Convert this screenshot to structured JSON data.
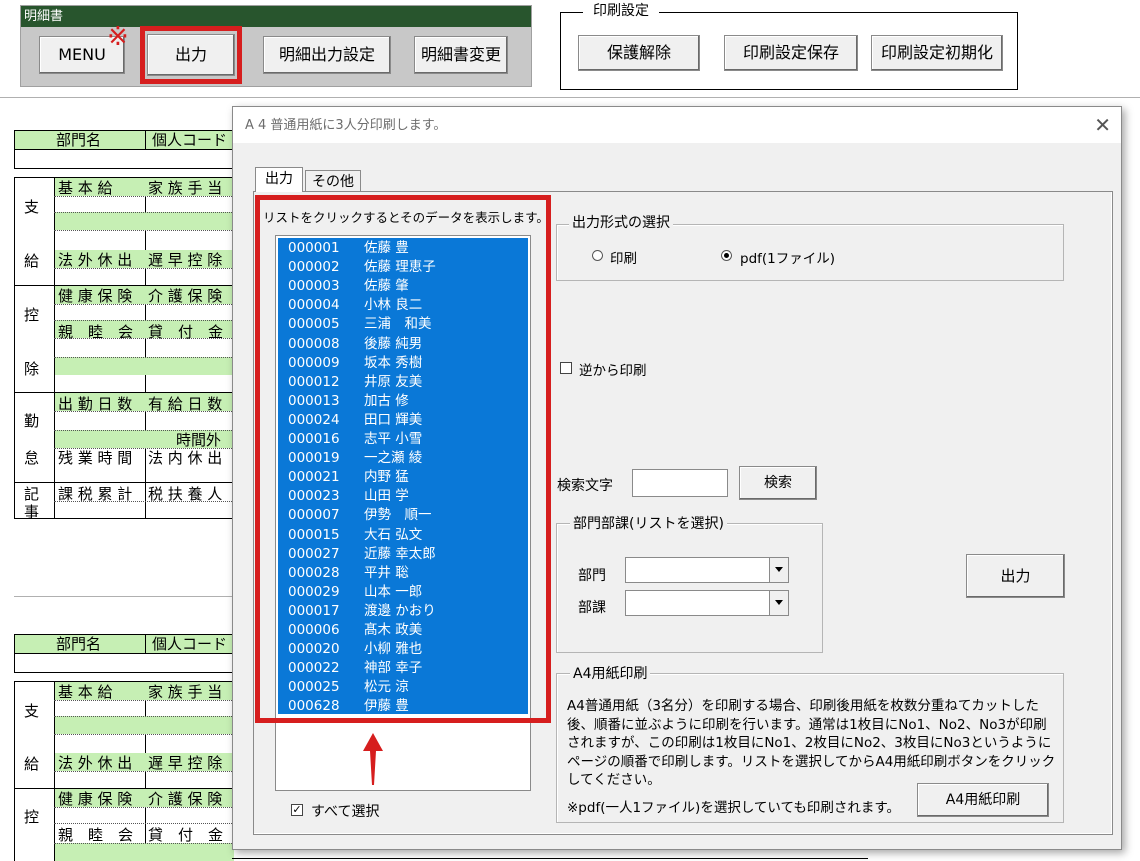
{
  "meisai_panel": {
    "title": "明細書",
    "buttons": {
      "menu": "MENU",
      "output": "出力",
      "settings": "明細出力設定",
      "change": "明細書変更"
    }
  },
  "print_settings": {
    "title": "印刷設定",
    "buttons": {
      "unprotect": "保護解除",
      "save": "印刷設定保存",
      "reset": "印刷設定初期化"
    }
  },
  "sheet": {
    "dept_header": "部門名",
    "personal_code_header": "個人コード",
    "side_labels": {
      "pay1": "支",
      "pay2": "給",
      "ded1": "控",
      "ded2": "除",
      "att1": "勤",
      "att2": "怠",
      "note1": "記",
      "note2": "事"
    },
    "cells": {
      "base_pay": "基 本 給",
      "family_allowance": "家 族 手 当",
      "leave_allowance": "法 外 休 出",
      "early_leave": "遅 早 控 除",
      "health_insurance": "健 康 保 険",
      "care_insurance": "介 護 保 険",
      "fellowship": "親　睦　会",
      "loan": "貸　付　金",
      "work_days": "出 勤 日 数",
      "paid_leave_days": "有 給 日 数",
      "overtime": "時間外",
      "overtime_hours": "残 業 時 間",
      "legal_holiday": "法 内 休 出",
      "taxable_total": "課 税 累 計",
      "tax_dependents": "税 扶 養 人"
    }
  },
  "dialog": {
    "title": "A 4 普通用紙に3人分印刷します。",
    "tabs": [
      "出力",
      "その他"
    ],
    "list_hint": "リストをクリックするとそのデータを表示します。",
    "list_items": [
      {
        "code": "000001",
        "name": "佐藤 豊"
      },
      {
        "code": "000002",
        "name": "佐藤 理恵子"
      },
      {
        "code": "000003",
        "name": "佐藤 肇"
      },
      {
        "code": "000004",
        "name": "小林 良二"
      },
      {
        "code": "000005",
        "name": "三浦　和美"
      },
      {
        "code": "000008",
        "name": "後藤 純男"
      },
      {
        "code": "000009",
        "name": "坂本 秀樹"
      },
      {
        "code": "000012",
        "name": "井原 友美"
      },
      {
        "code": "000013",
        "name": "加古 修"
      },
      {
        "code": "000024",
        "name": "田口 輝美"
      },
      {
        "code": "000016",
        "name": "志平 小雪"
      },
      {
        "code": "000019",
        "name": "一之瀬 綾"
      },
      {
        "code": "000021",
        "name": "内野 猛"
      },
      {
        "code": "000023",
        "name": "山田 学"
      },
      {
        "code": "000007",
        "name": "伊勢　順一"
      },
      {
        "code": "000015",
        "name": "大石 弘文"
      },
      {
        "code": "000027",
        "name": "近藤 幸太郎"
      },
      {
        "code": "000028",
        "name": "平井 聡"
      },
      {
        "code": "000029",
        "name": "山本 一郎"
      },
      {
        "code": "000017",
        "name": "渡邊 かおり"
      },
      {
        "code": "000006",
        "name": "髙木 政美"
      },
      {
        "code": "000020",
        "name": "小柳 雅也"
      },
      {
        "code": "000022",
        "name": "神部 幸子"
      },
      {
        "code": "000025",
        "name": "松元 涼"
      },
      {
        "code": "000628",
        "name": "伊藤 豊"
      }
    ],
    "select_all_label": "すべて選択",
    "select_all_checked": true,
    "output_format": {
      "title": "出力形式の選択",
      "option_print": "印刷",
      "option_pdf": "pdf(1ファイル)",
      "selected": "pdf(1ファイル)"
    },
    "reverse_print_label": "逆から印刷",
    "reverse_print_checked": false,
    "search_label": "検索文字",
    "search_value": "",
    "search_button": "検索",
    "dept_group": {
      "title": "部門部課(リストを選択)",
      "dept_label": "部門",
      "dept_value": "",
      "section_label": "部課",
      "section_value": ""
    },
    "output_button": "出力",
    "a4_group": {
      "title": "A4用紙印刷",
      "description": "A4普通用紙（3名分）を印刷する場合、印刷後用紙を枚数分重ねてカットした後、順番に並ぶように印刷を行います。通常は1枚目にNo1、No2、No3が印刷されますが、この印刷は1枚目にNo1、2枚目にNo2、3枚目にNo3というようにページの順番で印刷します。リストを選択してからA4用紙印刷ボタンをクリックしてください。",
      "note": "※pdf(一人1ファイル)を選択していても印刷されます。",
      "button": "A4用紙印刷"
    }
  },
  "annotation_mark": "※",
  "colors": {
    "list_selection": "#0a78d7",
    "highlight_red": "#d61e1e",
    "title_green": "#28552d",
    "cell_green": "#c6efb4"
  }
}
